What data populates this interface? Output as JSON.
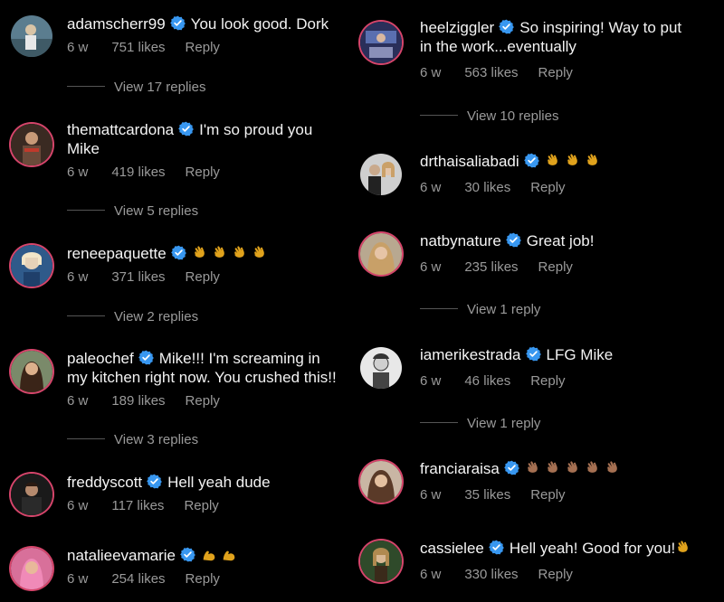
{
  "left": [
    {
      "user": "adamscherr99",
      "msg": "You look good.  Dork",
      "msg2": "",
      "time": "6 w",
      "likes": "751 likes",
      "reply": "Reply",
      "view": "View 17 replies",
      "emoji": ""
    },
    {
      "user": "themattcardona",
      "msg": "I'm so proud you",
      "msg2": "Mike",
      "time": "6 w",
      "likes": "419 likes",
      "reply": "Reply",
      "view": "View 5 replies",
      "emoji": ""
    },
    {
      "user": "reneepaquette",
      "msg": "",
      "msg2": "",
      "time": "6 w",
      "likes": "371 likes",
      "reply": "Reply",
      "view": "View 2 replies",
      "emoji": "clap-icon x4"
    },
    {
      "user": "paleochef",
      "msg": "Mike!!! I'm screaming in",
      "msg2": "my kitchen right now. You crushed this!!",
      "time": "6 w",
      "likes": "189 likes",
      "reply": "Reply",
      "view": "View 3 replies",
      "emoji": ""
    },
    {
      "user": "freddyscott",
      "msg": "Hell yeah dude",
      "msg2": "",
      "time": "6 w",
      "likes": "117 likes",
      "reply": "Reply",
      "view": "",
      "emoji": ""
    },
    {
      "user": "natalieevamarie",
      "msg": "",
      "msg2": "",
      "time": "6 w",
      "likes": "254 likes",
      "reply": "Reply",
      "view": "",
      "emoji": "flexed-arm-icon x2"
    }
  ],
  "right": [
    {
      "user": "heelziggler",
      "msg": "So inspiring! Way to put",
      "msg2": "in the work...eventually",
      "time": "6 w",
      "likes": "563 likes",
      "reply": "Reply",
      "view": "View 10 replies",
      "emoji": ""
    },
    {
      "user": "drthaisaliabadi",
      "msg": "",
      "msg2": "",
      "time": "6 w",
      "likes": "30 likes",
      "reply": "Reply",
      "view": "",
      "emoji": "clap-icon x3"
    },
    {
      "user": "natbynature",
      "msg": "Great job!",
      "msg2": "",
      "time": "6 w",
      "likes": "235 likes",
      "reply": "Reply",
      "view": "View 1 reply",
      "emoji": ""
    },
    {
      "user": "iamerikestrada",
      "msg": "LFG Mike",
      "msg2": "",
      "time": "6 w",
      "likes": "46 likes",
      "reply": "Reply",
      "view": "View 1 reply",
      "emoji": ""
    },
    {
      "user": "franciaraisa",
      "msg": "",
      "msg2": "",
      "time": "6 w",
      "likes": "35 likes",
      "reply": "Reply",
      "view": "",
      "emoji": "clap-icon-brown x5"
    },
    {
      "user": "cassielee",
      "msg": "Hell yeah! Good for you!",
      "msg2": "",
      "time": "6 w",
      "likes": "330 likes",
      "reply": "Reply",
      "view": "",
      "emoji": "clap-icon"
    }
  ],
  "colors": {
    "background": "#000000",
    "text": "#f2f2f2",
    "muted": "#9a9a9a",
    "verified": "#3897f0",
    "story_ring": "#d6456b",
    "clap_yellow": "#e0a21c",
    "clap_brown": "#a57052"
  }
}
